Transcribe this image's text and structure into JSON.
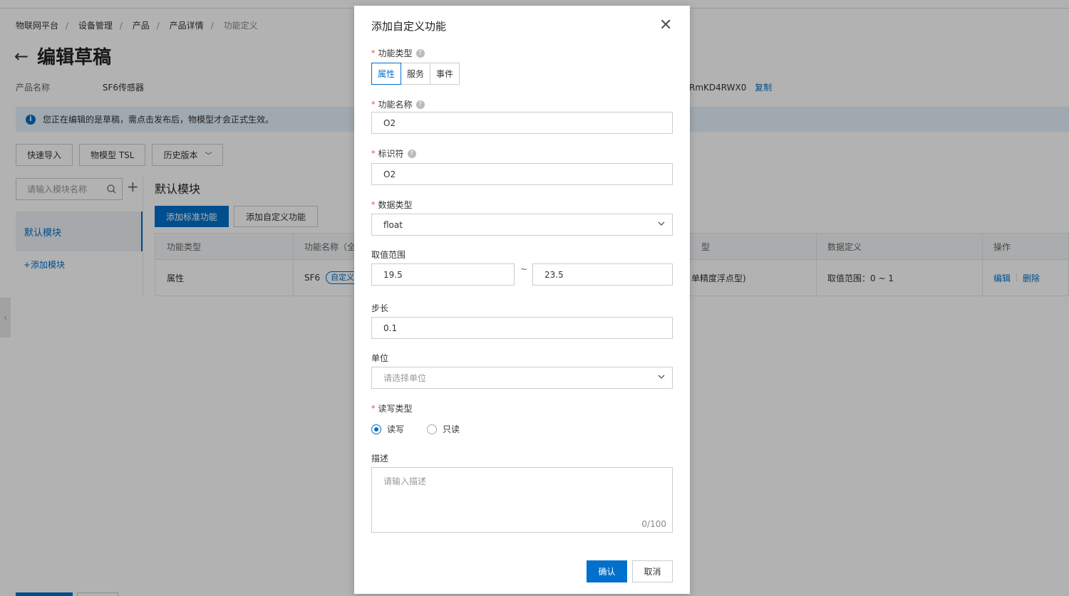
{
  "breadcrumb": [
    "物联网平台",
    "设备管理",
    "产品",
    "产品详情",
    "功能定义"
  ],
  "page": {
    "title": "编辑草稿",
    "product_label": "产品名称",
    "product_name": "SF6传感器",
    "product_key_partial": "RmKD4RWX0",
    "copy_link": "复制",
    "notice": "您正在编辑的是草稿，需点击发布后，物模型才会正式生效。",
    "toolbar": [
      "快速导入",
      "物模型 TSL",
      "历史版本"
    ],
    "module_search_placeholder": "请输入模块名称",
    "module_selected": "默认模块",
    "add_module": "+添加模块",
    "section_title": "默认模块",
    "add_standard": "添加标准功能",
    "add_custom": "添加自定义功能",
    "table": {
      "headers": [
        "功能类型",
        "功能名称（全",
        "型",
        "数据定义",
        "操作"
      ],
      "row": {
        "type": "属性",
        "name": "SF6",
        "tag": "自定义",
        "datatype": "单精度浮点型)",
        "definition": "取值范围：0 ~ 1",
        "edit": "编辑",
        "delete": "删除"
      }
    }
  },
  "dialog": {
    "title": "添加自定义功能",
    "function_type_label": "功能类型",
    "function_types": [
      "属性",
      "服务",
      "事件"
    ],
    "selected_type": "属性",
    "name_label": "功能名称",
    "name_value": "O2",
    "identifier_label": "标识符",
    "identifier_value": "O2",
    "datatype_label": "数据类型",
    "datatype_value": "float",
    "range_label": "取值范围",
    "range_min": "19.5",
    "range_sep": "~",
    "range_max": "23.5",
    "step_label": "步长",
    "step_value": "0.1",
    "unit_label": "单位",
    "unit_placeholder": "请选择单位",
    "rw_label": "读写类型",
    "rw_options": [
      "读写",
      "只读"
    ],
    "rw_selected": "读写",
    "desc_label": "描述",
    "desc_placeholder": "请输入描述",
    "desc_counter": "0/100",
    "confirm": "确认",
    "cancel": "取消"
  },
  "colors": {
    "primary": "#0070cc",
    "required": "#e43e3e",
    "overlay": "rgba(0,0,0,0.3)"
  }
}
